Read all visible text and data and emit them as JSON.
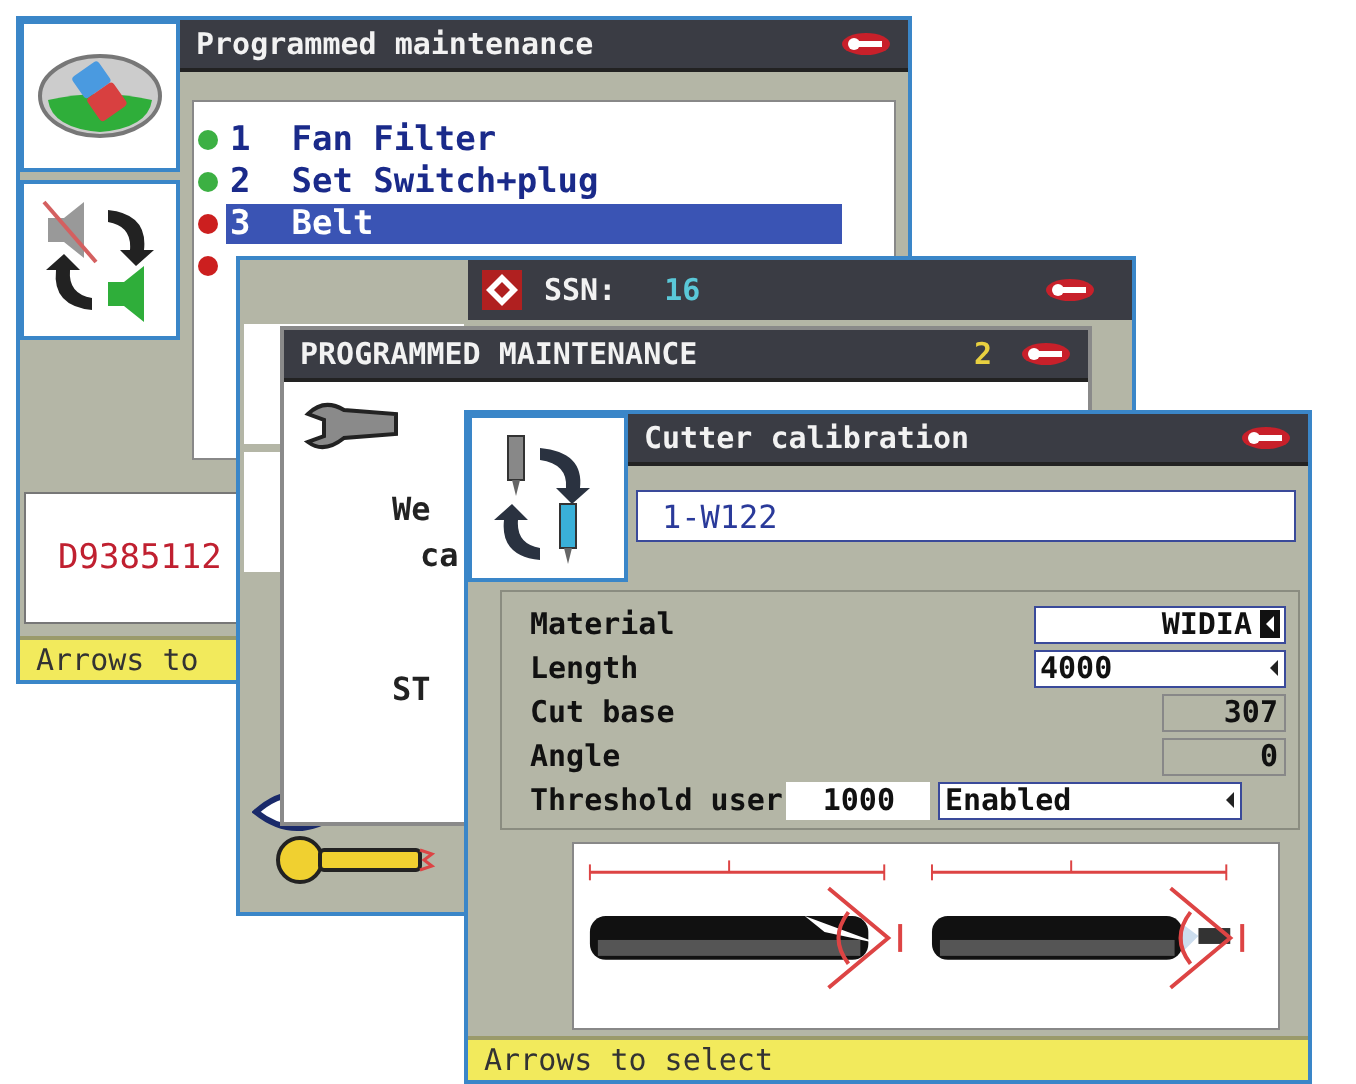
{
  "windows": [
    {
      "kind": "maintenance_list",
      "title": "Programmed maintenance",
      "items": [
        {
          "number": "1",
          "label": "Fan Filter",
          "color": "#3cb043",
          "selected": false
        },
        {
          "number": "2",
          "label": "Set Switch+plug",
          "color": "#3cb043",
          "selected": false
        },
        {
          "number": "3",
          "label": "Belt",
          "color": "#cc1f1f",
          "selected": true
        },
        {
          "color": "#cc1f1f"
        }
      ],
      "code": "D9385112",
      "status": "Arrows to"
    },
    {
      "kind": "ssn",
      "title": "SSN:",
      "value": "16"
    },
    {
      "kind": "message",
      "title": "PROGRAMMED MAINTENANCE",
      "count": "2",
      "lines": [
        "We",
        "ca",
        "ST"
      ]
    },
    {
      "kind": "calibration",
      "title": "Cutter calibration",
      "key_code": "1-W122",
      "fields": [
        {
          "label": "Material",
          "kind": "dropdown",
          "value": "WIDIA",
          "focused": true
        },
        {
          "label": "Length",
          "kind": "dropdown",
          "value": "4000",
          "focused": false
        },
        {
          "label": "Cut base",
          "kind": "readonly",
          "value": "307"
        },
        {
          "label": "Angle",
          "kind": "readonly",
          "value": "0"
        },
        {
          "label": "Threshold user",
          "kind": "threshold",
          "value": "1000",
          "option": "Enabled"
        }
      ],
      "status": "Arrows to select"
    }
  ]
}
